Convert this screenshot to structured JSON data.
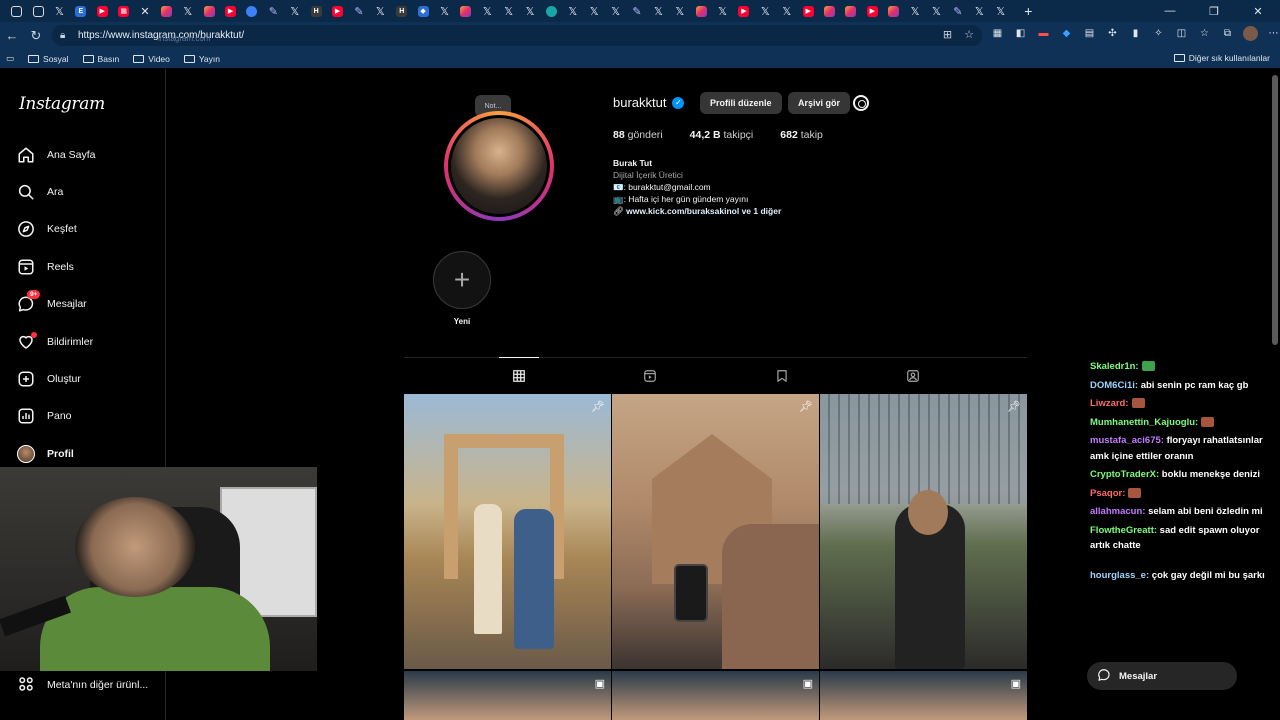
{
  "browser": {
    "url": "https://www.instagram.com/burakktut/",
    "url_hint": "instagram.com",
    "bookmarks": [
      {
        "label": "Sosyal"
      },
      {
        "label": "Basın"
      },
      {
        "label": "Video"
      },
      {
        "label": "Yayın"
      }
    ],
    "other_bookmarks": "Diğer sık kullanılanlar"
  },
  "sidebar": {
    "logo": "Instagram",
    "items": [
      {
        "label": "Ana Sayfa",
        "icon": "home-icon"
      },
      {
        "label": "Ara",
        "icon": "search-icon"
      },
      {
        "label": "Keşfet",
        "icon": "compass-icon"
      },
      {
        "label": "Reels",
        "icon": "reels-icon"
      },
      {
        "label": "Mesajlar",
        "icon": "messenger-icon",
        "badge": "9+"
      },
      {
        "label": "Bildirimler",
        "icon": "heart-icon"
      },
      {
        "label": "Oluştur",
        "icon": "plus-square-icon"
      },
      {
        "label": "Pano",
        "icon": "dashboard-icon"
      },
      {
        "label": "Profil",
        "icon": "avatar"
      }
    ],
    "more": "Meta'nın diğer ürünl..."
  },
  "profile": {
    "note": "Not...",
    "username": "burakktut",
    "edit_button": "Profili düzenle",
    "archive_button": "Arşivi gör",
    "stats": {
      "posts_value": "88",
      "posts_label": "gönderi",
      "followers_value": "44,2 B",
      "followers_label": "takipçi",
      "following_value": "682",
      "following_label": "takip"
    },
    "bio": {
      "name": "Burak Tut",
      "category": "Dijital İçerik Üretici",
      "line1": "📧: burakktut@gmail.com",
      "line2": "📺: Hafta içi her gün gündem yayını",
      "link": "www.kick.com/buraksakinol ve 1 diğer"
    },
    "highlight_new": "Yeni"
  },
  "chat": [
    {
      "user": "Skaledr1n:",
      "text": "",
      "color": "#7cfc7c"
    },
    {
      "user": "DOM6Ci1i:",
      "text": "abi senin pc ram kaç gb",
      "color": "#9fd3ff"
    },
    {
      "user": "Liwzard:",
      "text": "",
      "color": "#ff6b6b"
    },
    {
      "user": "Mumhanettin_Kajuoglu:",
      "text": "",
      "color": "#7cfc7c"
    },
    {
      "user": "mustafa_aci675:",
      "text": "floryayı rahatlatsınlar amk içine ettiler oranın",
      "color": "#c37cff"
    },
    {
      "user": "CryptoTraderX:",
      "text": "boklu menekşe denizi",
      "color": "#7cfc7c"
    },
    {
      "user": "Psaqor:",
      "text": "",
      "color": "#ff6b6b"
    },
    {
      "user": "allahmacun:",
      "text": "selam abi beni özledin mi",
      "color": "#c37cff"
    },
    {
      "user": "FlowtheGreatt:",
      "text": "sad edit spawn oluyor artık chatte",
      "color": "#7cfc7c"
    },
    {
      "user": "hourglass_e:",
      "text": "çok gay değil mi bu şarkı",
      "color": "#9fd3ff"
    }
  ],
  "messages_pill": "Mesajlar"
}
